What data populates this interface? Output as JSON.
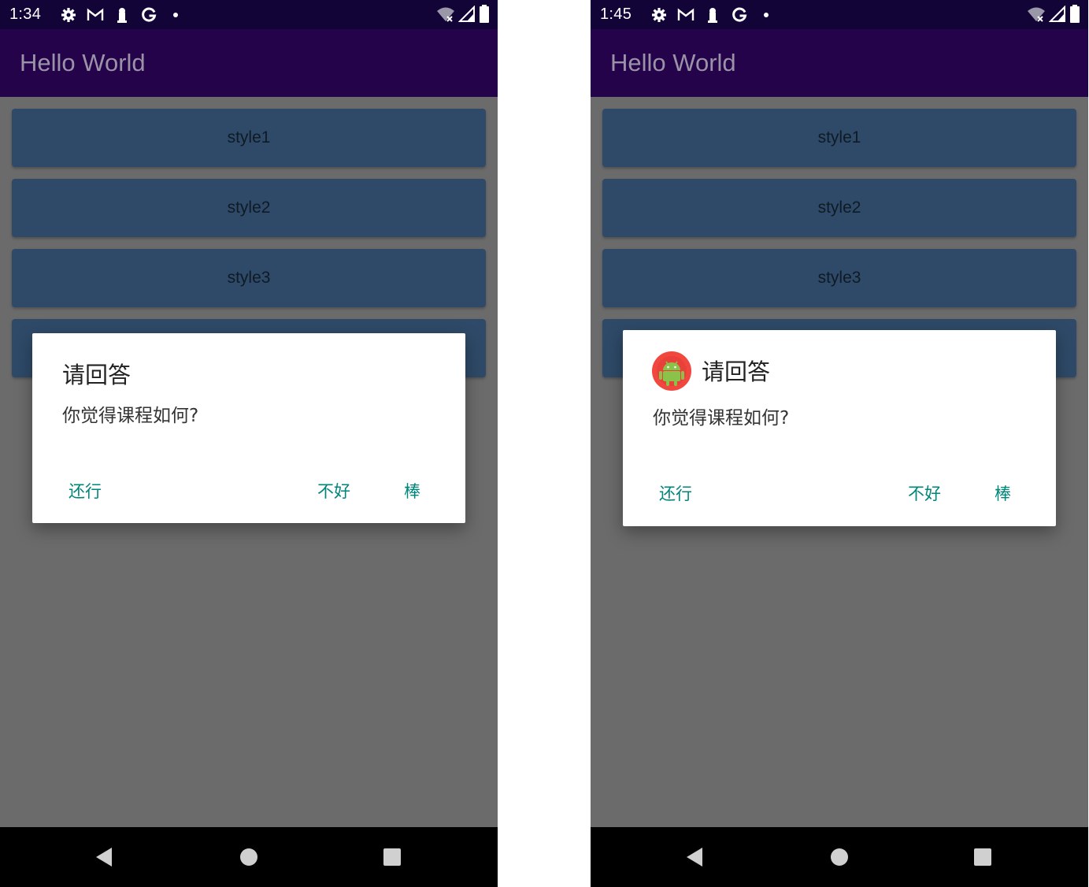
{
  "screens": [
    {
      "status_bar": {
        "time": "1:34",
        "left_icons": [
          "gear-icon",
          "gmail-icon",
          "keyhole-icon",
          "google-g-icon",
          "dot-icon"
        ],
        "right_icons": [
          "wifi-off-icon",
          "signal-icon",
          "battery-icon"
        ]
      },
      "app_bar": {
        "title": "Hello World"
      },
      "buttons": [
        {
          "label": "style1"
        },
        {
          "label": "style2"
        },
        {
          "label": "style3"
        },
        {
          "label": ""
        }
      ],
      "dialog": {
        "has_icon": false,
        "title": "请回答",
        "message": "你觉得课程如何?",
        "neutral_button": "还行",
        "negative_button": "不好",
        "positive_button": "棒"
      },
      "nav_bar": {
        "icons": [
          "back-icon",
          "home-icon",
          "recents-icon"
        ]
      }
    },
    {
      "status_bar": {
        "time": "1:45",
        "left_icons": [
          "gear-icon",
          "gmail-icon",
          "keyhole-icon",
          "google-g-icon",
          "dot-icon"
        ],
        "right_icons": [
          "wifi-off-icon",
          "signal-icon",
          "battery-icon"
        ]
      },
      "app_bar": {
        "title": "Hello World"
      },
      "buttons": [
        {
          "label": "style1"
        },
        {
          "label": "style2"
        },
        {
          "label": "style3"
        },
        {
          "label": ""
        }
      ],
      "dialog": {
        "has_icon": true,
        "icon": "android-robot-icon",
        "title": "请回答",
        "message": "你觉得课程如何?",
        "neutral_button": "还行",
        "negative_button": "不好",
        "positive_button": "棒"
      },
      "nav_bar": {
        "icons": [
          "back-icon",
          "home-icon",
          "recents-icon"
        ]
      }
    }
  ],
  "colors": {
    "status_bar_bg": "#130438",
    "app_bar_bg": "#24034a",
    "scrim_bg": "#6b6b6b",
    "button_bg": "#2e4a68",
    "dialog_button_text": "#00857a",
    "nav_bar_bg": "#000000"
  }
}
